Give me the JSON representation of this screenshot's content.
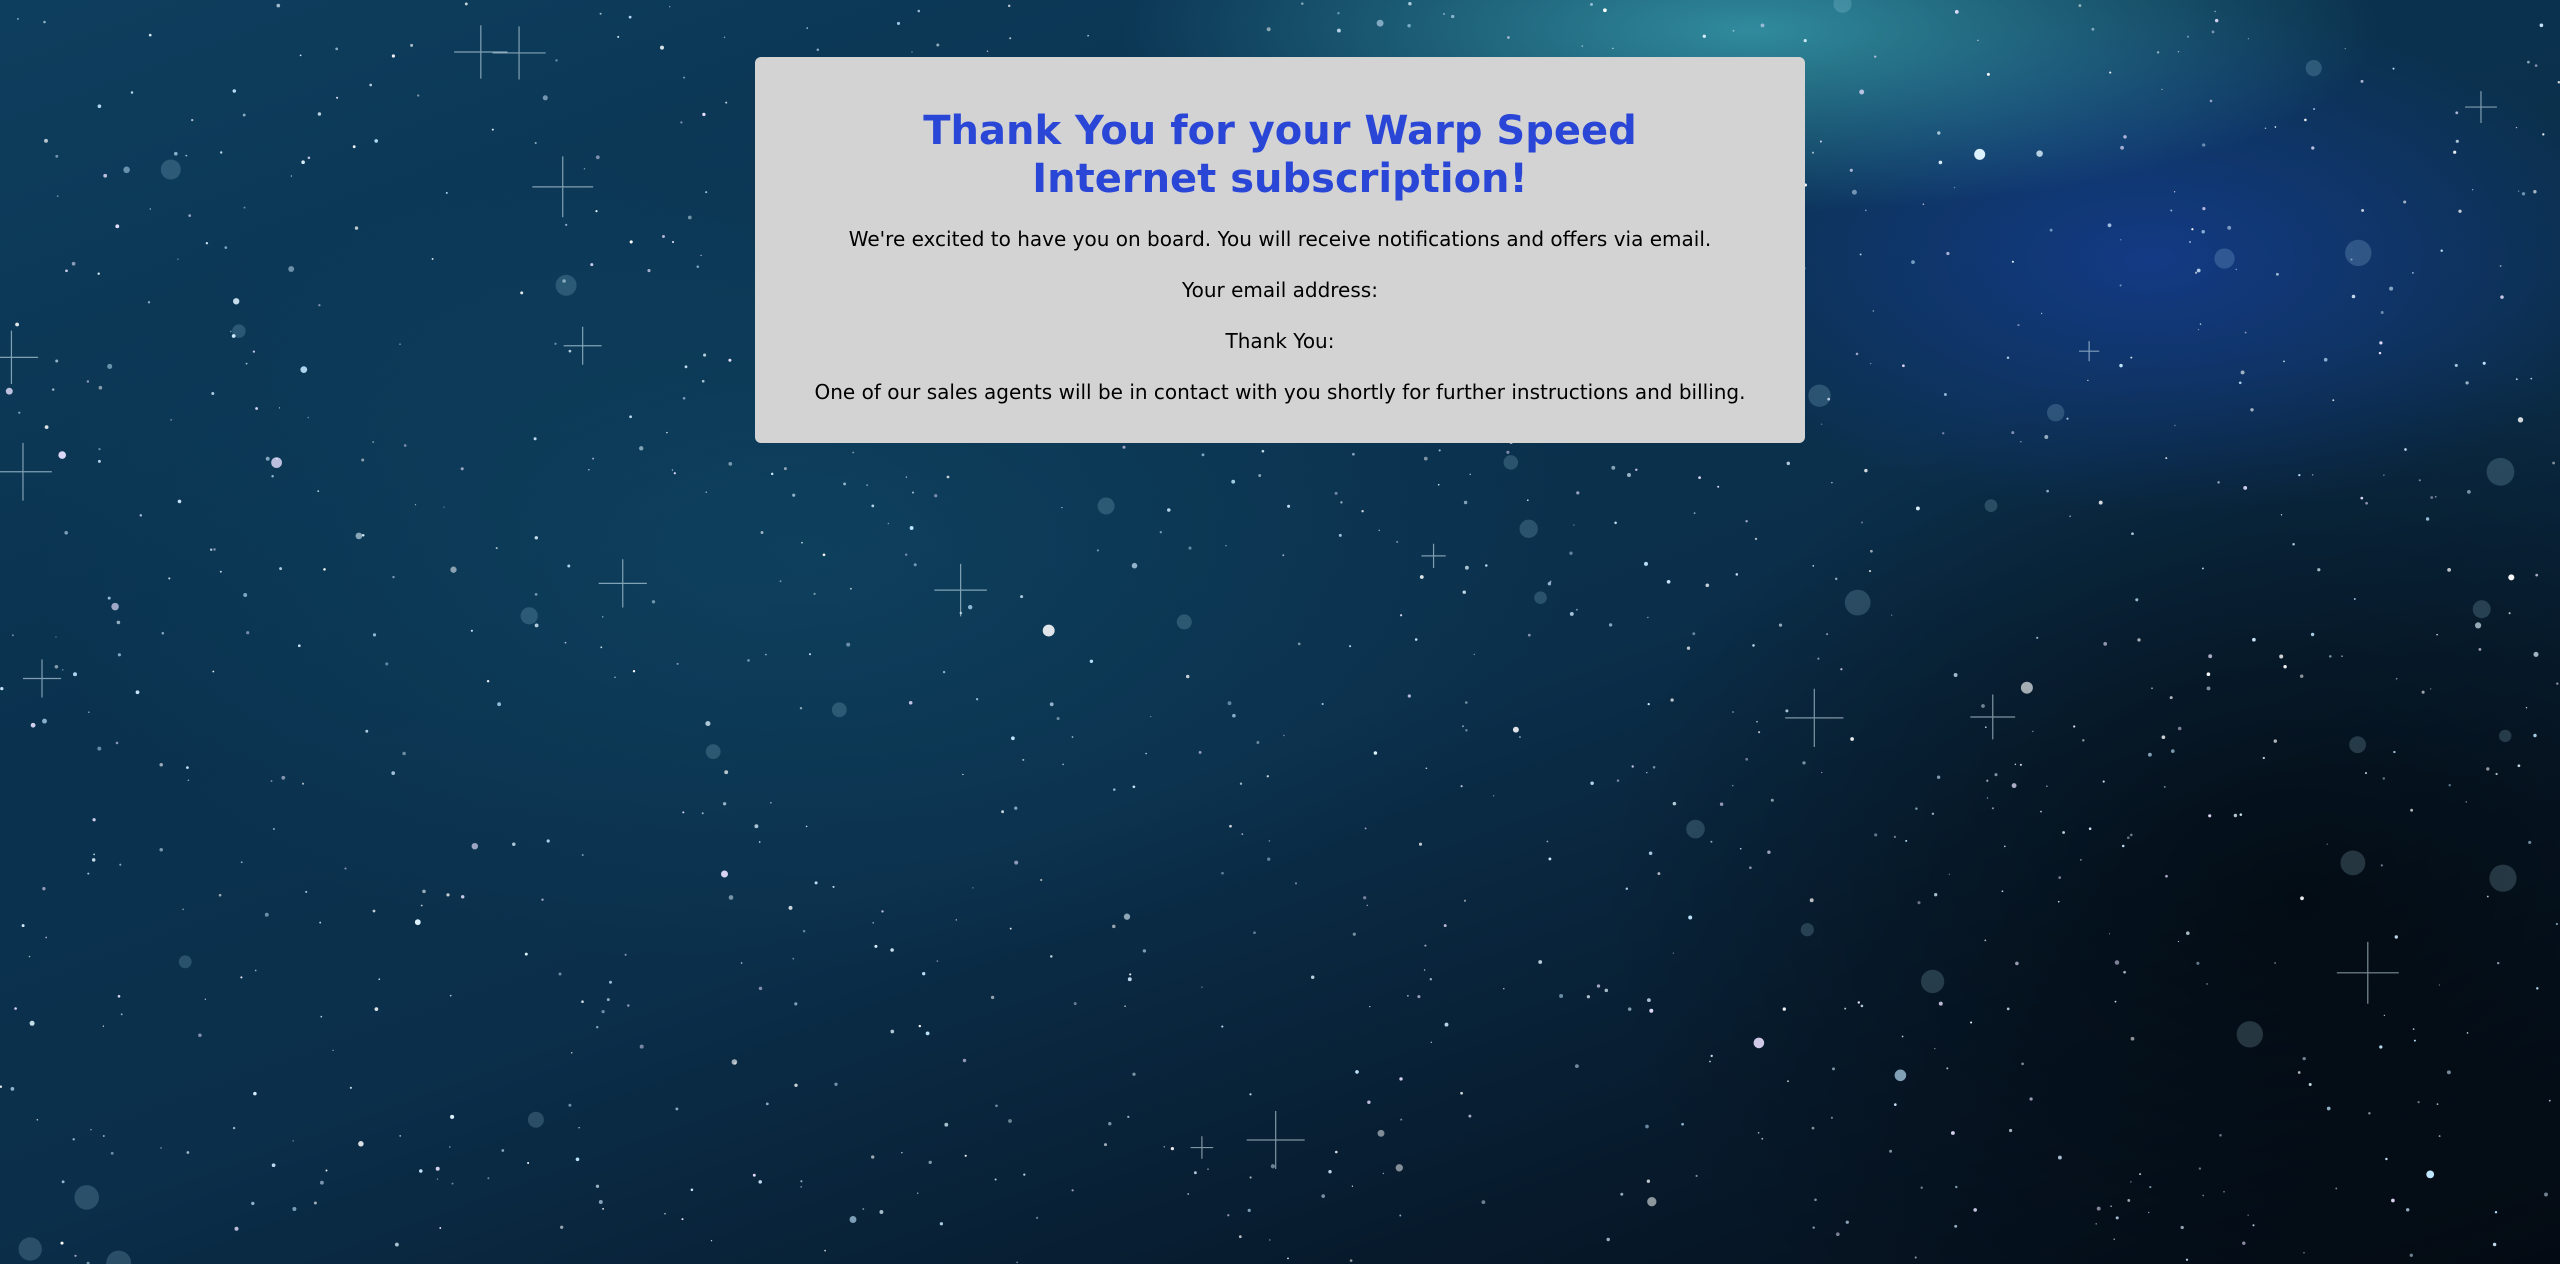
{
  "page": {
    "background": "starfield-background",
    "heading": "Thank You for your Warp Speed Internet subscription!",
    "intro": "We're excited to have you on board. You will receive notifications and offers via email.",
    "email_label": "Your email address:",
    "thank_you_label": "Thank You:",
    "closing": "One of our sales agents will be in contact with you shortly for further instructions and billing."
  },
  "colors": {
    "heading": "#2a46d6",
    "card_background": "#d3d3d3",
    "text": "#000000"
  }
}
